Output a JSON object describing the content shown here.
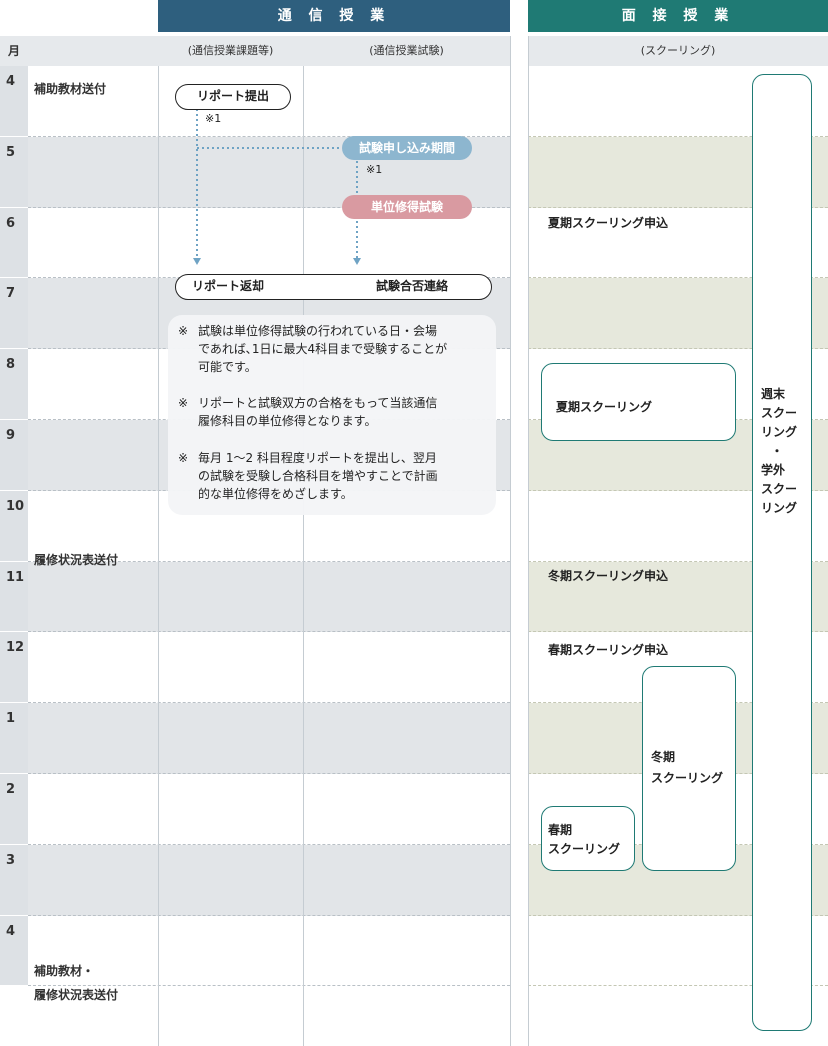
{
  "headers": {
    "correspondence": "通 信 授 業",
    "face_to_face": "面 接 授 業",
    "month_col": "月",
    "sub_assign": "(通信授業課題等)",
    "sub_exam": "(通信授業試験)",
    "sub_schooling": "(スクーリング)"
  },
  "months": [
    "4",
    "5",
    "6",
    "7",
    "8",
    "9",
    "10",
    "11",
    "12",
    "1",
    "2",
    "3",
    "4"
  ],
  "row_labels": {
    "r0": "補助教材送付",
    "r6": "履修状況表送付",
    "r12a": "補助教材・",
    "r12b": "履修状況表送付"
  },
  "flow": {
    "report_submit": "リポート提出",
    "note1a": "※1",
    "exam_apply": "試験申し込み期間",
    "note1b": "※1",
    "credit_exam": "単位修得試験",
    "report_return": "リポート返却",
    "exam_result": "試験合否連絡"
  },
  "notes": {
    "mark": "※",
    "n1a": "試験は単位修得試験の行われている日・会場",
    "n1b": "であれば､1日に最大4科目まで受験することが",
    "n1c": "可能です。",
    "n2a": "リポートと試験双方の合格をもって当該通信",
    "n2b": "履修科目の単位修得となります。",
    "n3a": "毎月 1〜2 科目程度リポートを提出し、翌月",
    "n3b": "の試験を受験し合格科目を増やすことで計画",
    "n3c": "的な単位修得をめざします。"
  },
  "schooling": {
    "summer_apply": "夏期スクーリング申込",
    "summer": "夏期スクーリング",
    "winter_apply": "冬期スクーリング申込",
    "spring_apply": "春期スクーリング申込",
    "winter_a": "冬期",
    "winter_b": "スクーリング",
    "spring_a": "春期",
    "spring_b": "スクーリング",
    "weekend": [
      "週末",
      "スクー",
      "リング",
      "・",
      "学外",
      "スクー",
      "リング"
    ]
  },
  "colors": {
    "header_blue": "#2e5f7e",
    "header_green": "#1f7a74",
    "row_gray": "#e2e5e8",
    "row_olive": "#e6e8dc",
    "apply_pill": "#8db6cf",
    "exam_pill": "#d99aa1"
  }
}
